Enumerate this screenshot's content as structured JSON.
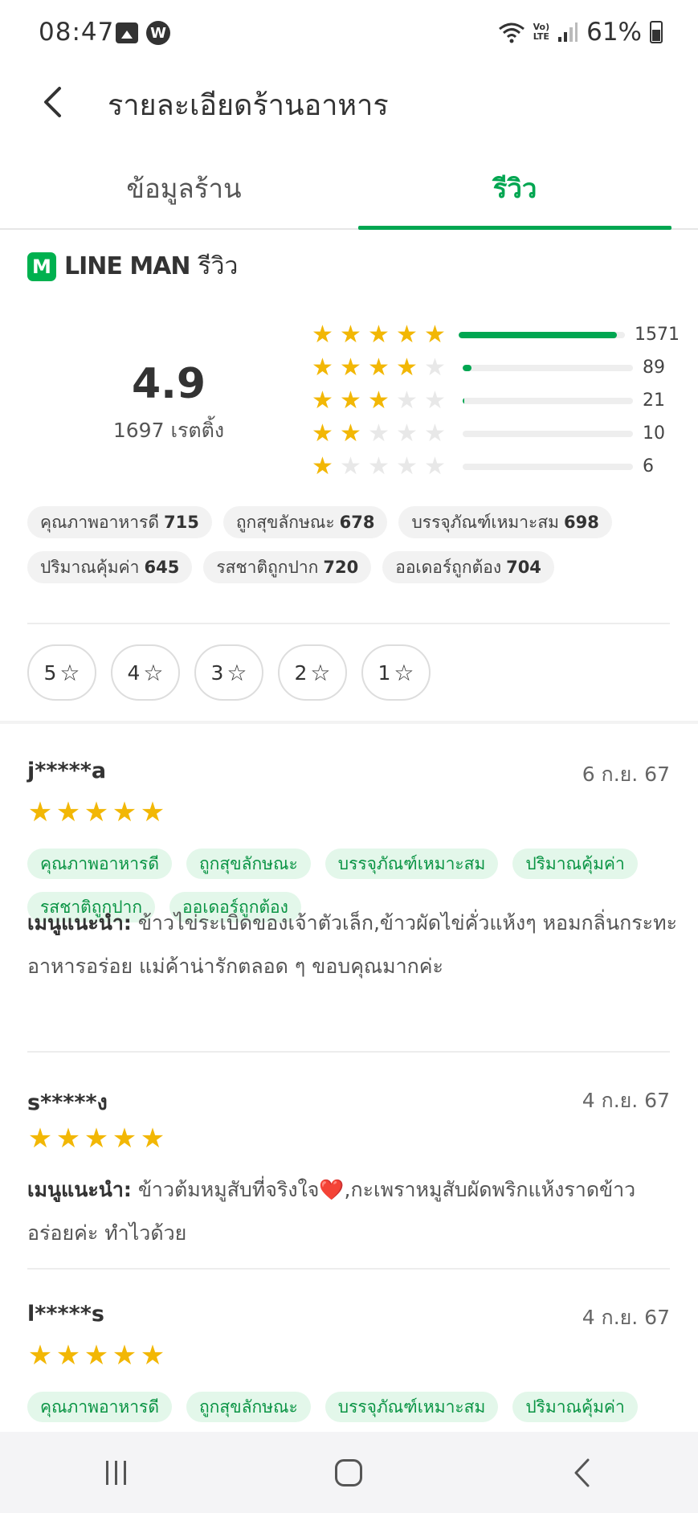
{
  "status_bar": {
    "time": "08:47",
    "battery": "61%",
    "lte_top": "Vo)",
    "lte_bottom": "LTE",
    "w_badge": "W"
  },
  "header": {
    "title": "รายละเอียดร้านอาหาร"
  },
  "tabs": [
    {
      "label": "ข้อมูลร้าน",
      "active": false
    },
    {
      "label": "รีวิว",
      "active": true
    }
  ],
  "brand": {
    "logo_letter": "M",
    "name": "LINE MAN",
    "suffix": "รีวิว"
  },
  "summary": {
    "rating": "4.9",
    "rating_count": "1697 เรตติ้ง",
    "distribution": [
      {
        "stars": 5,
        "count": "1571",
        "fill": 0.95
      },
      {
        "stars": 4,
        "count": "89",
        "fill": 0.05
      },
      {
        "stars": 3,
        "count": "21",
        "fill": 0.01
      },
      {
        "stars": 2,
        "count": "10",
        "fill": 0
      },
      {
        "stars": 1,
        "count": "6",
        "fill": 0
      }
    ],
    "chips": [
      {
        "label": "คุณภาพอาหารดี",
        "count": "715"
      },
      {
        "label": "ถูกสุขลักษณะ",
        "count": "678"
      },
      {
        "label": "บรรจุภัณฑ์เหมาะสม",
        "count": "698"
      },
      {
        "label": "ปริมาณคุ้มค่า",
        "count": "645"
      },
      {
        "label": "รสชาติถูกปาก",
        "count": "720"
      },
      {
        "label": "ออเดอร์ถูกต้อง",
        "count": "704"
      }
    ]
  },
  "filters": [
    "5",
    "4",
    "3",
    "2",
    "1"
  ],
  "reviews": [
    {
      "user": "j*****a",
      "date": "6 ก.ย. 67",
      "stars": 5,
      "chips": [
        "คุณภาพอาหารดี",
        "ถูกสุขลักษณะ",
        "บรรจุภัณฑ์เหมาะสม",
        "ปริมาณคุ้มค่า",
        "รสชาติถูกปาก",
        "ออเดอร์ถูกต้อง"
      ],
      "menu_label": "เมนูแนะนำ:",
      "menu_text": "ข้าวไข่ระเบิดของเจ้าตัวเล็ก,ข้าวผัดไข่คั่วแห้งๆ หอมกลิ่นกระทะ",
      "comment": "อาหารอร่อย แม่ค้าน่ารักตลอด ๆ ขอบคุณมากค่ะ"
    },
    {
      "user": "s*****ง",
      "date": "4 ก.ย. 67",
      "stars": 5,
      "chips": [],
      "menu_label": "เมนูแนะนำ:",
      "menu_text": "ข้าวต้มหมูสับที่จริงใจ❤️,กะเพราหมูสับผัดพริกแห้งราดข้าว",
      "comment": "อร่อยค่ะ ทำไวด้วย"
    },
    {
      "user": "l*****s",
      "date": "4 ก.ย. 67",
      "stars": 5,
      "chips": [
        "คุณภาพอาหารดี",
        "ถูกสุขลักษณะ",
        "บรรจุภัณฑ์เหมาะสม",
        "ปริมาณคุ้มค่า"
      ]
    }
  ],
  "colors": {
    "accent": "#00a651",
    "star": "#f2b705",
    "chip_green_bg": "#e3f7ea"
  }
}
